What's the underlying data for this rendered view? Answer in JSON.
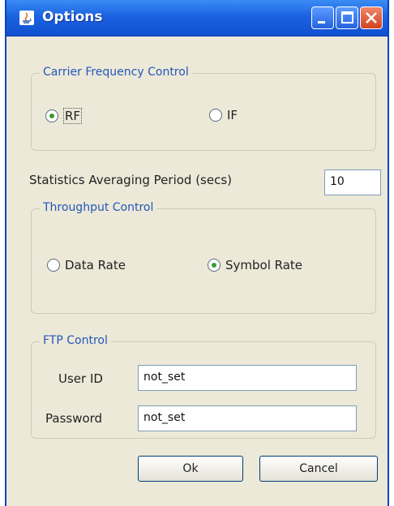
{
  "window": {
    "title": "Options",
    "app_icon": "java-icon",
    "controls": [
      "minimize-icon",
      "maximize-icon",
      "close-icon"
    ]
  },
  "carrier": {
    "legend": "Carrier Frequency Control",
    "rf_label": "RF",
    "if_label": "IF",
    "selected": "RF"
  },
  "stats": {
    "label": "Statistics Averaging Period (secs)",
    "value": "10"
  },
  "throughput": {
    "legend": "Throughput Control",
    "data_rate_label": "Data Rate",
    "symbol_rate_label": "Symbol Rate",
    "selected": "Symbol Rate"
  },
  "ftp": {
    "legend": "FTP Control",
    "user_label": "User ID",
    "user_value": "not_set",
    "password_label": "Password",
    "password_value": "not_set"
  },
  "buttons": {
    "ok": "Ok",
    "cancel": "Cancel"
  },
  "colors": {
    "titlebar": "#1b62e0",
    "legend_text": "#2356b8",
    "window_bg": "#ece9d8",
    "radio_dot": "#3a9a37"
  }
}
